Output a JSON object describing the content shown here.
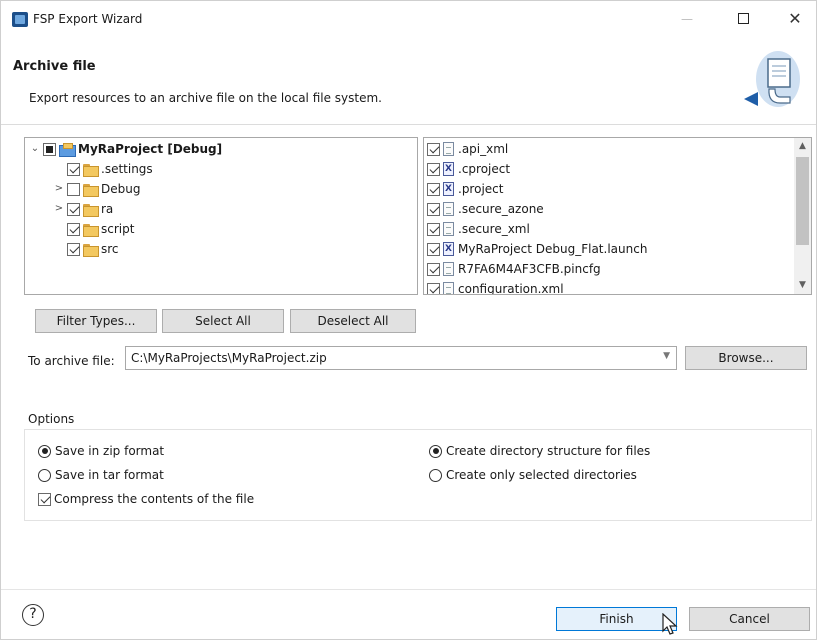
{
  "window": {
    "title": "FSP Export Wizard",
    "minimize": "—",
    "close": "✕"
  },
  "banner": {
    "title": "Archive file",
    "description": "Export resources to an archive file on the local file system."
  },
  "tree": {
    "root": {
      "label": "MyRaProject [Debug]",
      "state": "partial",
      "expanded": true
    },
    "items": [
      {
        "label": ".settings",
        "checked": true,
        "expander": ""
      },
      {
        "label": "Debug",
        "checked": false,
        "expander": ">"
      },
      {
        "label": "ra",
        "checked": true,
        "expander": ">"
      },
      {
        "label": "script",
        "checked": true,
        "expander": ""
      },
      {
        "label": "src",
        "checked": true,
        "expander": ""
      }
    ]
  },
  "files": [
    {
      "label": ".api_xml",
      "icon": "file-icon",
      "checked": true
    },
    {
      "label": ".cproject",
      "icon": "xml-file-icon",
      "checked": true
    },
    {
      "label": ".project",
      "icon": "xml-file-icon",
      "checked": true
    },
    {
      "label": ".secure_azone",
      "icon": "file-icon",
      "checked": true
    },
    {
      "label": ".secure_xml",
      "icon": "file-icon",
      "checked": true
    },
    {
      "label": "MyRaProject Debug_Flat.launch",
      "icon": "xml-file-icon",
      "checked": true
    },
    {
      "label": "R7FA6M4AF3CFB.pincfg",
      "icon": "file-icon",
      "checked": true
    },
    {
      "label": "configuration.xml",
      "icon": "file-icon",
      "checked": true
    }
  ],
  "buttons": {
    "filter_types": "Filter Types...",
    "select_all": "Select All",
    "deselect_all": "Deselect All",
    "browse": "Browse...",
    "finish": "Finish",
    "cancel": "Cancel"
  },
  "archive": {
    "label": "To archive file:",
    "value": "C:\\MyRaProjects\\MyRaProject.zip"
  },
  "options": {
    "label": "Options",
    "save_zip": "Save in zip format",
    "save_tar": "Save in tar format",
    "compress": "Compress the contents of the file",
    "create_dir_structure": "Create directory structure for files",
    "create_selected_dirs": "Create only selected directories",
    "save_zip_selected": true,
    "compress_checked": true,
    "dir_structure_selected": true
  },
  "help": {
    "glyph": "?"
  }
}
